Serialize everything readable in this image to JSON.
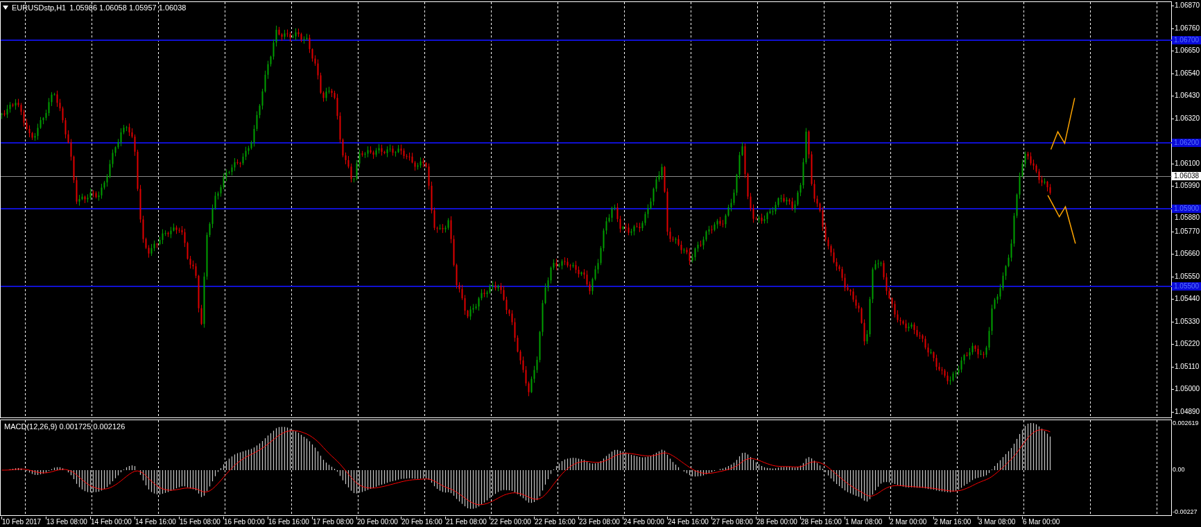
{
  "header": {
    "symbol": "EURUSDstp,H1",
    "ohlc": "1.05986 1.06058 1.05957 1.06038"
  },
  "price_axis": {
    "ticks": [
      "1.06870",
      "1.06760",
      "1.06650",
      "1.06540",
      "1.06430",
      "1.06320",
      "1.06100",
      "1.05990",
      "1.05880",
      "1.05770",
      "1.05660",
      "1.05550",
      "1.05440",
      "1.05330",
      "1.05220",
      "1.05110",
      "1.05000",
      "1.04890"
    ],
    "levels": [
      {
        "label": "1.06700"
      },
      {
        "label": "1.06200"
      },
      {
        "label": "1.05900"
      },
      {
        "label": "1.05500"
      }
    ],
    "current_price": "1.06038"
  },
  "macd": {
    "title": "MACD(12,26,9) 0.001725 0.002126",
    "axis": [
      "0.002619",
      "0.00",
      "-0.00227"
    ]
  },
  "time_axis": [
    "10 Feb 2017",
    "13 Feb 08:00",
    "14 Feb 00:00",
    "14 Feb 16:00",
    "15 Feb 08:00",
    "16 Feb 00:00",
    "16 Feb 16:00",
    "17 Feb 08:00",
    "20 Feb 00:00",
    "20 Feb 16:00",
    "21 Feb 08:00",
    "22 Feb 00:00",
    "22 Feb 16:00",
    "23 Feb 08:00",
    "24 Feb 00:00",
    "24 Feb 16:00",
    "27 Feb 08:00",
    "28 Feb 00:00",
    "28 Feb 16:00",
    "1 Mar 08:00",
    "2 Mar 00:00",
    "2 Mar 16:00",
    "3 Mar 08:00",
    "6 Mar 00:00"
  ]
}
